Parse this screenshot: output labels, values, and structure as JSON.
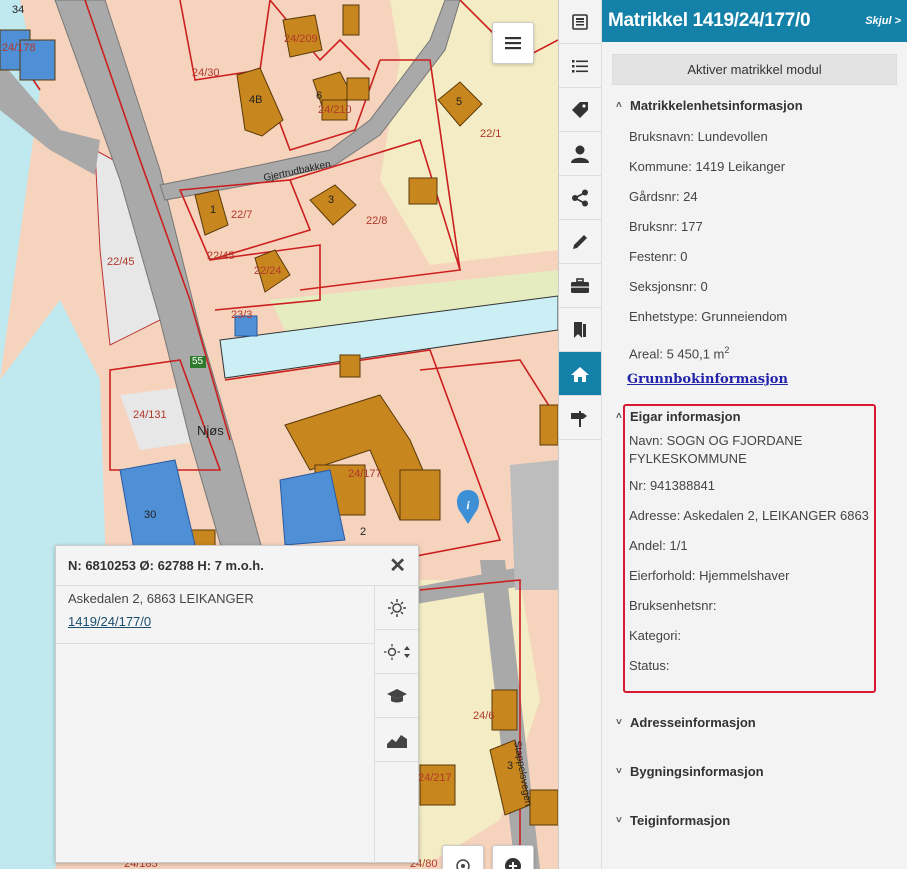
{
  "map": {
    "labels": [
      {
        "text": "34"
      },
      {
        "text": "24/178"
      },
      {
        "text": "24/30"
      },
      {
        "text": "24/209"
      },
      {
        "text": "4B"
      },
      {
        "text": "6"
      },
      {
        "text": "24/210"
      },
      {
        "text": "5"
      },
      {
        "text": "22/1"
      },
      {
        "text": "Gjertrudbakken"
      },
      {
        "text": "1"
      },
      {
        "text": "22/7"
      },
      {
        "text": "3"
      },
      {
        "text": "22/8"
      },
      {
        "text": "22/45"
      },
      {
        "text": "22/45"
      },
      {
        "text": "22/24"
      },
      {
        "text": "23/3"
      },
      {
        "text": "55"
      },
      {
        "text": "24/131"
      },
      {
        "text": "Njøs"
      },
      {
        "text": "24/177"
      },
      {
        "text": "30"
      },
      {
        "text": "2"
      },
      {
        "text": "24/6"
      },
      {
        "text": "24/217"
      },
      {
        "text": "3"
      },
      {
        "text": "Stappelsvegen"
      },
      {
        "text": "24/185"
      },
      {
        "text": "24/80"
      }
    ]
  },
  "popup": {
    "coords": "N: 6810253 Ø: 62788 H: 7 m.o.h.",
    "address": "Askedalen 2, 6863 LEIKANGER",
    "matrikkel_link": "1419/24/177/0"
  },
  "toolbar": {
    "icons": [
      "document-icon",
      "list-icon",
      "tag-icon",
      "person-icon",
      "share-icon",
      "pencil-icon",
      "briefcase-icon",
      "bookmark-icon",
      "home-icon",
      "signpost-icon"
    ]
  },
  "panel": {
    "title": "Matrikkel 1419/24/177/0",
    "hide_label": "Skjul >",
    "activate_label": "Aktiver matrikkel modul",
    "matrikkel_section": {
      "title": "Matrikkelenhetsinformasjon",
      "rows": [
        "Bruksnavn: Lundevollen",
        "Kommune: 1419 Leikanger",
        "Gårdsnr: 24",
        "Bruksnr: 177",
        "Festenr: 0",
        "Seksjonsnr: 0",
        "Enhetstype: Grunneiendom"
      ],
      "area_label": "Areal: 5 450,1 m",
      "area_sup": "2"
    },
    "grunnbok_link": "Grunnbokinformasjon",
    "eigar_section": {
      "title": "Eigar informasjon",
      "navn_line1": "Navn: SOGN OG FJORDANE",
      "navn_line2": "FYLKESKOMMUNE",
      "rows": [
        "Nr: 941388841",
        "Adresse: Askedalen 2, LEIKANGER 6863",
        "Andel: 1/1",
        "Eierforhold: Hjemmelshaver",
        "Bruksenhetsnr:",
        "Kategori:",
        "Status:"
      ]
    },
    "collapsed_sections": [
      "Adresseinformasjon",
      "Bygningsinformasjon",
      "Teiginformasjon"
    ]
  },
  "colors": {
    "accent": "#1481a9",
    "highlight": "#d71933",
    "property_line": "#cc1f1f",
    "building": "#c8861e",
    "road": "#a9a9a9",
    "water": "#bfe9ef"
  }
}
